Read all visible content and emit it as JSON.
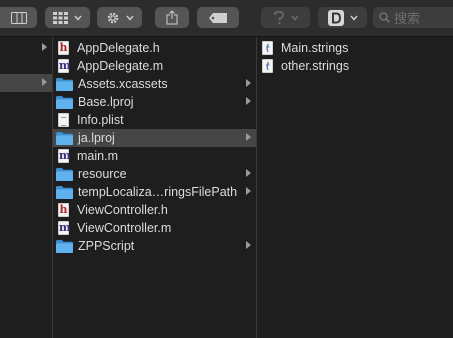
{
  "toolbar": {
    "search_placeholder": "搜索",
    "colors": {
      "toolbar_bg": "#2c2c2c",
      "button_bg": "#555555",
      "window_bg": "#1e1e1e"
    },
    "icons": [
      "view-columns-icon",
      "view-options-icon",
      "gear-icon",
      "share-icon",
      "tag-icon",
      "help-icon",
      "dash-app-icon",
      "search-icon"
    ]
  },
  "column2": {
    "items": [
      {
        "label": "AppDelegate.h",
        "icon": "h-file-icon",
        "has_children": false,
        "selected": false
      },
      {
        "label": "AppDelegate.m",
        "icon": "m-file-icon",
        "has_children": false,
        "selected": false
      },
      {
        "label": "Assets.xcassets",
        "icon": "folder-icon",
        "has_children": true,
        "selected": false
      },
      {
        "label": "Base.lproj",
        "icon": "folder-icon",
        "has_children": true,
        "selected": false
      },
      {
        "label": "Info.plist",
        "icon": "plist-file-icon",
        "has_children": false,
        "selected": false
      },
      {
        "label": "ja.lproj",
        "icon": "folder-icon",
        "has_children": true,
        "selected": true
      },
      {
        "label": "main.m",
        "icon": "m-file-icon",
        "has_children": false,
        "selected": false
      },
      {
        "label": "resource",
        "icon": "folder-icon",
        "has_children": true,
        "selected": false
      },
      {
        "label": "tempLocaliza…ringsFilePath",
        "icon": "folder-icon",
        "has_children": true,
        "selected": false
      },
      {
        "label": "ViewController.h",
        "icon": "h-file-icon",
        "has_children": false,
        "selected": false
      },
      {
        "label": "ViewController.m",
        "icon": "m-file-icon",
        "has_children": false,
        "selected": false
      },
      {
        "label": "ZPPScript",
        "icon": "folder-icon",
        "has_children": true,
        "selected": false
      }
    ]
  },
  "column3": {
    "items": [
      {
        "label": "Main.strings",
        "icon": "strings-file-icon"
      },
      {
        "label": "other.strings",
        "icon": "strings-file-icon"
      }
    ]
  }
}
